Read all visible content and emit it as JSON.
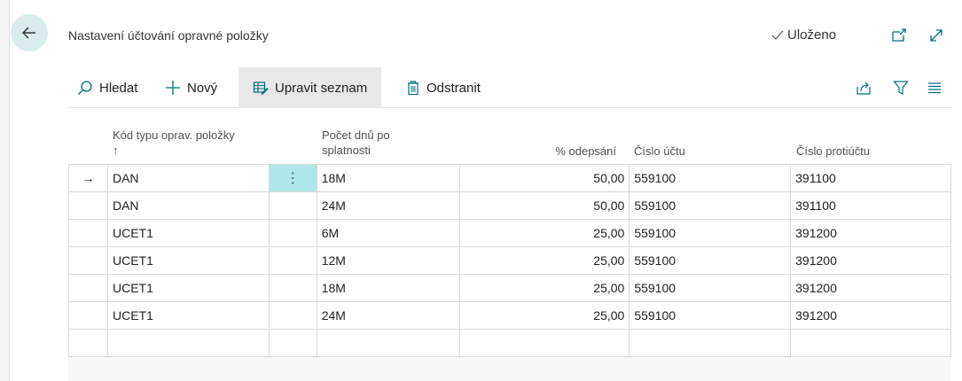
{
  "page": {
    "title": "Nastavení účtování opravné položky",
    "saved_label": "Uloženo"
  },
  "actions": {
    "search": "Hledat",
    "new": "Nový",
    "edit_list": "Upravit seznam",
    "delete": "Odstranit"
  },
  "columns": {
    "code": "Kód typu oprav. položky",
    "sort_indicator": "↑",
    "days_line1": "Počet dnů po",
    "days_line2": "splatnosti",
    "percent": "% odepsání",
    "account": "Číslo účtu",
    "balancing_account": "Číslo protiúčtu"
  },
  "selected_row_indicator": "→",
  "rows": [
    {
      "code": "DAN",
      "days": "18M",
      "percent": "50,00",
      "account": "559100",
      "balancing_account": "391100"
    },
    {
      "code": "DAN",
      "days": "24M",
      "percent": "50,00",
      "account": "559100",
      "balancing_account": "391100"
    },
    {
      "code": "UCET1",
      "days": "6M",
      "percent": "25,00",
      "account": "559100",
      "balancing_account": "391200"
    },
    {
      "code": "UCET1",
      "days": "12M",
      "percent": "25,00",
      "account": "559100",
      "balancing_account": "391200"
    },
    {
      "code": "UCET1",
      "days": "18M",
      "percent": "25,00",
      "account": "559100",
      "balancing_account": "391200"
    },
    {
      "code": "UCET1",
      "days": "24M",
      "percent": "25,00",
      "account": "559100",
      "balancing_account": "391200"
    }
  ],
  "icons": {
    "back": "back-arrow-icon",
    "saved": "checkmark-icon",
    "open_new_window": "open-in-new-window-icon",
    "expand": "expand-icon",
    "search": "search-icon",
    "new": "plus-icon",
    "edit_list": "edit-list-icon",
    "delete": "trash-icon",
    "share": "share-icon",
    "filter": "filter-icon",
    "list_view": "list-view-icon",
    "row_menu": "vertical-dots-icon"
  },
  "colors": {
    "accent": "#00707a",
    "back_button_bg": "#d9ecee",
    "active_cell": "#aee6ea",
    "active_action_bg": "#e8e8e8"
  }
}
